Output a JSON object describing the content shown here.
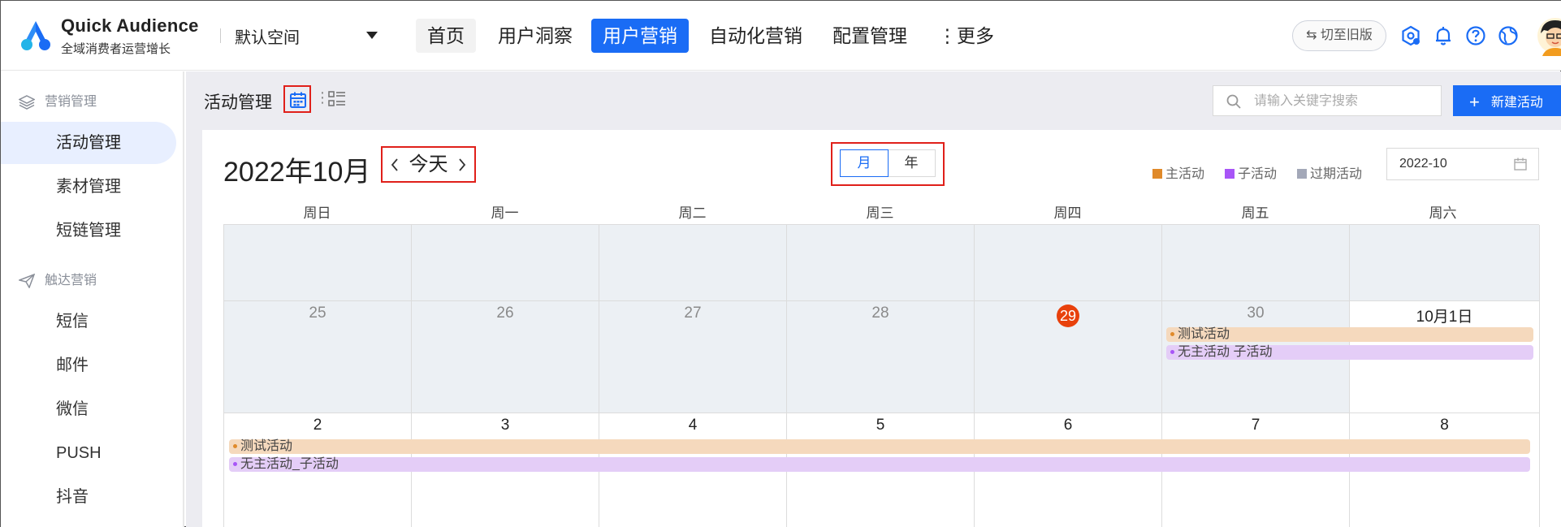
{
  "header": {
    "brand_name": "Quick Audience",
    "brand_sub": "全域消费者运营增长",
    "workspace": "默认空间",
    "nav": [
      "首页",
      "用户洞察",
      "用户营销",
      "自动化营销",
      "配置管理",
      "⋮更多"
    ],
    "legacy_label": "⇆ 切至旧版"
  },
  "sidebar": {
    "group1": "营销管理",
    "group1_items": [
      "活动管理",
      "素材管理",
      "短链管理"
    ],
    "group2": "触达营销",
    "group2_items": [
      "短信",
      "邮件",
      "微信",
      "PUSH",
      "抖音"
    ]
  },
  "toolbar": {
    "title": "活动管理",
    "search_placeholder": "请输入关键字搜索",
    "new_label": "新建活动"
  },
  "calendar": {
    "month_title": "2022年10月",
    "today_label": "今天",
    "mode_month": "月",
    "mode_year": "年",
    "legend": [
      "主活动",
      "子活动",
      "过期活动"
    ],
    "date_value": "2022-10",
    "weekdays": [
      "周日",
      "周一",
      "周二",
      "周三",
      "周四",
      "周五",
      "周六"
    ],
    "row2": [
      "25",
      "26",
      "27",
      "28",
      "29",
      "30",
      "10月1日"
    ],
    "row3": [
      "2",
      "3",
      "4",
      "5",
      "6",
      "7",
      "8"
    ],
    "events": {
      "main": "测试活动",
      "sub_row2": "无主活动 子活动",
      "sub_row3": "无主活动_子活动"
    }
  },
  "colors": {
    "accent": "#1a6cf5",
    "main_activity": "#e08a2a",
    "sub_activity": "#a855f7",
    "expired_activity": "#a3a8b8",
    "today": "#e8410c"
  }
}
